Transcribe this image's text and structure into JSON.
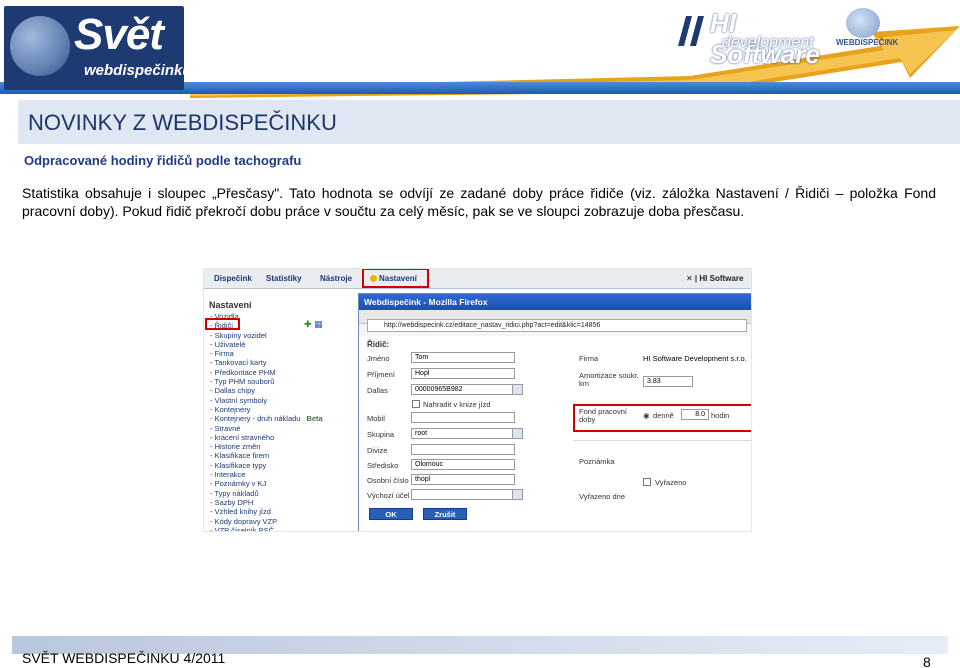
{
  "header": {
    "brand_title": "Svět",
    "brand_sub": "webdispečinku",
    "partner_logo_title": "HI Software",
    "partner_logo_sub": "development",
    "small_logo_text": "WEBDISPEČINK"
  },
  "page_title": "NOVINKY Z WEBDISPEČINKU",
  "subtitle": "Odpracované hodiny řidičů podle tachografu",
  "paragraph": "Statistika obsahuje i sloupec „Přesčasy\". Tato hodnota se odvíjí ze zadané doby práce řidiče (viz. záložka Nastavení / Řidiči – položka Fond pracovní doby). Pokud řidič překročí dobu práce v součtu za celý měsíc, pak se ve sloupci zobrazuje doba přesčasu.",
  "screenshot": {
    "menu": [
      "Dispečink",
      "Statistiky",
      "Nástroje",
      "Nastavení"
    ],
    "menu_right": "✕ | HI Software",
    "sidebar_title": "Nastavení",
    "sidebar_items": [
      "- Vozidla",
      "- Řidiči",
      "- Skupiny vozidel",
      "- Uživatelé",
      "- Firma",
      "- Tankovací karty",
      "- Předkontace PHM",
      "- Typ PHM souborů",
      "- Dallas chipy",
      "- Vlastní symboly",
      "- Kontejnery",
      "- Kontejnery - druh nákladu",
      "- Stravné",
      "  - krácení stravného",
      "- Historie změn",
      "- Klasifikace firem",
      "- Klasifikace typy",
      "- Interakce",
      "- Poznámky v KJ",
      "- Typy nákladů",
      "- Sazby DPH",
      "- Vzhled knihy jízd",
      "- Kódy dopravy VZP",
      "- VZP číselník PSČ"
    ],
    "beta_label": "Beta",
    "window_title": "Webdispečink - Mozilla Firefox",
    "url": "http://webdispecink.cz/editace_nastav_ridici.php?act=edit&klic=14856",
    "form_header": "Řidič:",
    "fields": {
      "jmeno_label": "Jméno",
      "jmeno_value": "Tom",
      "prijmeni_label": "Příjmení",
      "prijmeni_value": "Hopl",
      "dallas_label": "Dallas",
      "dallas_value": "00000965B982",
      "nahradit_label": "Nahradit v knize jízd",
      "mobil_label": "Mobil",
      "skupina_label": "Skupina",
      "skupina_value": "root",
      "divize_label": "Divize",
      "stredisko_label": "Středisko",
      "stredisko_value": "Olomouc",
      "osobni_label": "Osobní číslo",
      "osobni_value": "thopl",
      "vychozi_label": "Výchozí účel",
      "firma_label": "Firma",
      "firma_value": "HI Software Development s.r.o.",
      "amort_label": "Amortizace soukr. km",
      "amort_value": "3.83",
      "fond_label": "Fond pracovní doby",
      "fond_radio_label": "denně",
      "fond_value": "8.0",
      "fond_unit": "hodin",
      "poznamka_label": "Poznámka",
      "vyrazeno_label": "Vyřazeno",
      "vyrazeno_dne_label": "Vyřazeno dne"
    },
    "ok_label": "OK",
    "cancel_label": "Zrušit"
  },
  "footer": {
    "text": "SVĚT WEBDISPEČINKU 4/2011",
    "page_number": "8"
  }
}
